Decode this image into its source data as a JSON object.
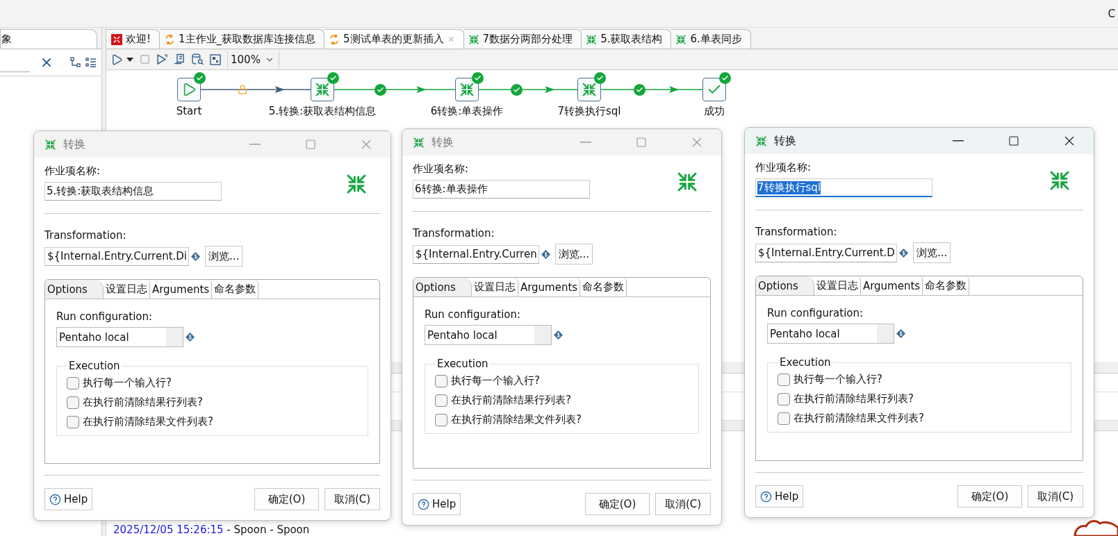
{
  "corner_text": "C",
  "left_panel": {
    "tab_label": "象"
  },
  "editor_tabs": [
    {
      "label": "欢迎!",
      "kind": "welcome",
      "selected": false
    },
    {
      "label": "1主作业_获取数据库连接信息",
      "kind": "job",
      "selected": false
    },
    {
      "label": "5测试单表的更新插入",
      "kind": "job",
      "selected": true
    },
    {
      "label": "7数据分两部分处理",
      "kind": "transformation",
      "selected": false
    },
    {
      "label": "5.获取表结构",
      "kind": "transformation",
      "selected": false
    },
    {
      "label": "6.单表同步",
      "kind": "transformation",
      "selected": false
    }
  ],
  "toolbar": {
    "zoom": "100%"
  },
  "job_flow": {
    "nodes": [
      {
        "label": "Start",
        "kind": "start",
        "succeeded": true
      },
      {
        "label": "5.转换:获取表结构信息",
        "kind": "transformation",
        "succeeded": true
      },
      {
        "label": "6转换:单表操作",
        "kind": "transformation",
        "succeeded": true
      },
      {
        "label": "7转换执行sql",
        "kind": "transformation",
        "succeeded": true
      },
      {
        "label": "成功",
        "kind": "success",
        "succeeded": true
      }
    ],
    "hops": [
      {
        "kind": "unconditional"
      },
      {
        "kind": "success"
      },
      {
        "kind": "success"
      },
      {
        "kind": "success"
      }
    ]
  },
  "log": {
    "timestamp": "2025/12/05 15:26:15",
    "message": " - Spoon - Spoon"
  },
  "dialogs": [
    {
      "title": "转换",
      "focused": false,
      "name_label": "作业项名称:",
      "name_value": "5.转换:获取表结构信息",
      "name_selected": false,
      "transformation_label": "Transformation:",
      "transformation_value": "${Internal.Entry.Current.Di",
      "browse": "浏览...",
      "tabs": [
        {
          "label": "Options",
          "selected": true
        },
        {
          "label": "设置日志",
          "selected": false
        },
        {
          "label": "Arguments",
          "selected": false
        },
        {
          "label": "命名参数",
          "selected": false
        }
      ],
      "run_config_label": "Run configuration:",
      "run_config_value": "Pentaho local",
      "execution_label": "Execution",
      "options": [
        {
          "label": "执行每一个输入行?",
          "checked": false
        },
        {
          "label": "在执行前清除结果行列表?",
          "checked": false
        },
        {
          "label": "在执行前清除结果文件列表?",
          "checked": false
        }
      ],
      "help": "Help",
      "ok": "确定(O)",
      "cancel": "取消(C)"
    },
    {
      "title": "转换",
      "focused": false,
      "name_label": "作业项名称:",
      "name_value": "6转换:单表操作",
      "name_selected": false,
      "transformation_label": "Transformation:",
      "transformation_value": "${Internal.Entry.Curren",
      "browse": "浏览...",
      "tabs": [
        {
          "label": "Options",
          "selected": true
        },
        {
          "label": "设置日志",
          "selected": false
        },
        {
          "label": "Arguments",
          "selected": false
        },
        {
          "label": "命名参数",
          "selected": false
        }
      ],
      "run_config_label": "Run configuration:",
      "run_config_value": "Pentaho local",
      "execution_label": "Execution",
      "options": [
        {
          "label": "执行每一个输入行?",
          "checked": false
        },
        {
          "label": "在执行前清除结果行列表?",
          "checked": false
        },
        {
          "label": "在执行前清除结果文件列表?",
          "checked": false
        }
      ],
      "help": "Help",
      "ok": "确定(O)",
      "cancel": "取消(C)"
    },
    {
      "title": "转换",
      "focused": true,
      "name_label": "作业项名称:",
      "name_value": "7转换执行sql",
      "name_selected": true,
      "transformation_label": "Transformation:",
      "transformation_value": "${Internal.Entry.Current.D",
      "browse": "浏览...",
      "tabs": [
        {
          "label": "Options",
          "selected": true
        },
        {
          "label": "设置日志",
          "selected": false
        },
        {
          "label": "Arguments",
          "selected": false
        },
        {
          "label": "命名参数",
          "selected": false
        }
      ],
      "run_config_label": "Run configuration:",
      "run_config_value": "Pentaho local",
      "execution_label": "Execution",
      "options": [
        {
          "label": "执行每一个输入行?",
          "checked": false
        },
        {
          "label": "在执行前清除结果行列表?",
          "checked": false
        },
        {
          "label": "在执行前清除结果文件列表?",
          "checked": false
        }
      ],
      "help": "Help",
      "ok": "确定(O)",
      "cancel": "取消(C)"
    }
  ]
}
